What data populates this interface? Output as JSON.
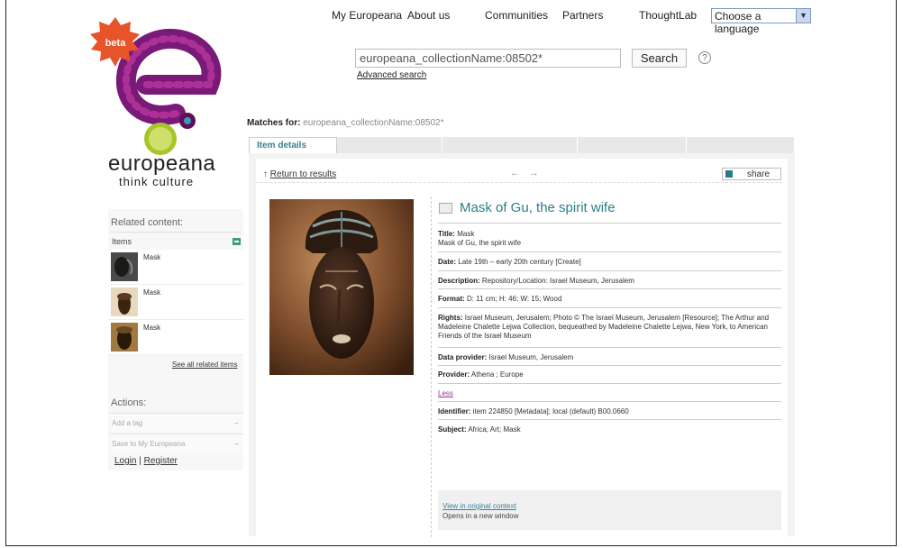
{
  "nav": {
    "items": [
      "My Europeana",
      "About us",
      "Communities",
      "Partners",
      "ThoughtLab"
    ],
    "language": "Choose a language"
  },
  "brand": {
    "badge": "beta",
    "name": "europeana",
    "tagline": "think culture"
  },
  "search": {
    "value": "europeana_collectionName:08502*",
    "button": "Search",
    "help": "?",
    "advanced": "Advanced search"
  },
  "matches": {
    "label": "Matches for:",
    "query": "europeana_collectionName:08502*"
  },
  "tabs": {
    "active": "Item details"
  },
  "toolbar": {
    "back": "Return to results",
    "back_arrow": "↑",
    "prev": "←",
    "next": "→",
    "share": "share"
  },
  "item": {
    "title": "Mask of Gu, the spirit wife",
    "fields": [
      {
        "label": "Title:",
        "value": "Mask",
        "extra": "Mask of Gu, the spirit wife"
      },
      {
        "label": "Date:",
        "value": "Late 19th – early 20th century [Create]"
      },
      {
        "label": "Description:",
        "value": "Repository/Location: Israel Museum, Jerusalem"
      },
      {
        "label": "Format:",
        "value": "D: 11 cm;  H: 46;  W: 15;  Wood"
      },
      {
        "label": "Rights:",
        "value": "Israel Museum, Jerusalem;  Photo © The Israel Museum, Jerusalem [Resource];  The Arthur and Madeleine Chalette Lejwa Collection, bequeathed by Madeleine Chalette Lejwa, New York, to American Friends of the Israel Museum"
      },
      {
        "label": "Data provider:",
        "value": "Israel Museum, Jerusalem"
      },
      {
        "label": "Provider:",
        "value": "Athena ;  Europe"
      },
      {
        "label": "Identifier:",
        "value": "item 224850 [Metadata];  local (default) B00.0660"
      },
      {
        "label": "Subject:",
        "value": "Africa;  Art;  Mask"
      }
    ],
    "less": "Less",
    "original_link": "View in original context",
    "original_note": "Opens in a new window"
  },
  "sidebar": {
    "related_heading": "Related content:",
    "items_label": "Items",
    "items": [
      {
        "label": "Mask"
      },
      {
        "label": "Mask"
      },
      {
        "label": "Mask"
      }
    ],
    "see_all": "See all related items",
    "actions_heading": "Actions:",
    "actions": [
      {
        "label": "Add a tag",
        "arrow": "→"
      },
      {
        "label": "Save to My Europeana",
        "arrow": "→"
      }
    ],
    "login": "Login",
    "separator": "|",
    "register": "Register"
  },
  "colors": {
    "accent": "#2d7e88",
    "logo_purple": "#7a1a78",
    "badge": "#e8542a"
  }
}
